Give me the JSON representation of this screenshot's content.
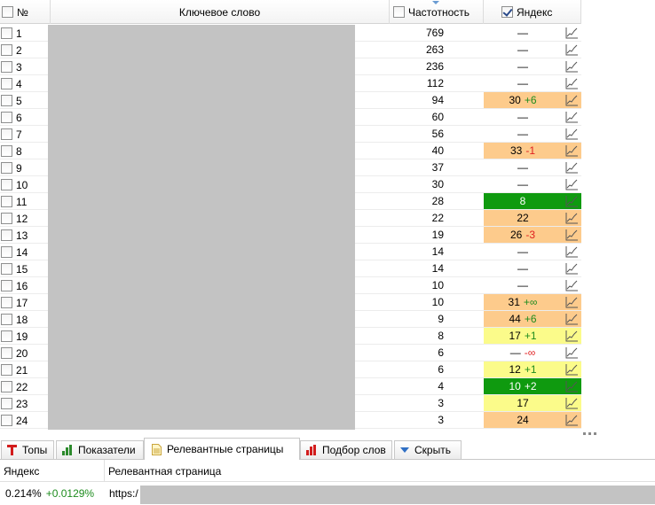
{
  "grid": {
    "columns": {
      "num": "№",
      "keyword": "Ключевое слово",
      "frequency": "Частотность",
      "yandex": "Яндекс"
    },
    "rows": [
      {
        "num": "1",
        "freq": "769",
        "rank": "—",
        "delta": "",
        "dir": "",
        "bg": ""
      },
      {
        "num": "2",
        "freq": "263",
        "rank": "—",
        "delta": "",
        "dir": "",
        "bg": ""
      },
      {
        "num": "3",
        "freq": "236",
        "rank": "—",
        "delta": "",
        "dir": "",
        "bg": ""
      },
      {
        "num": "4",
        "freq": "112",
        "rank": "—",
        "delta": "",
        "dir": "",
        "bg": ""
      },
      {
        "num": "5",
        "freq": "94",
        "rank": "30",
        "delta": "+6",
        "dir": "up",
        "bg": "#fdcb8c"
      },
      {
        "num": "6",
        "freq": "60",
        "rank": "—",
        "delta": "",
        "dir": "",
        "bg": ""
      },
      {
        "num": "7",
        "freq": "56",
        "rank": "—",
        "delta": "",
        "dir": "",
        "bg": ""
      },
      {
        "num": "8",
        "freq": "40",
        "rank": "33",
        "delta": "-1",
        "dir": "down",
        "bg": "#fdcb8c"
      },
      {
        "num": "9",
        "freq": "37",
        "rank": "—",
        "delta": "",
        "dir": "",
        "bg": ""
      },
      {
        "num": "10",
        "freq": "30",
        "rank": "—",
        "delta": "",
        "dir": "",
        "bg": ""
      },
      {
        "num": "11",
        "freq": "28",
        "rank": "8",
        "delta": "",
        "dir": "",
        "bg": "#0f9a0f",
        "fg": "#ffffff"
      },
      {
        "num": "12",
        "freq": "22",
        "rank": "22",
        "delta": "",
        "dir": "",
        "bg": "#fdcb8c"
      },
      {
        "num": "13",
        "freq": "19",
        "rank": "26",
        "delta": "-3",
        "dir": "down",
        "bg": "#fdcb8c"
      },
      {
        "num": "14",
        "freq": "14",
        "rank": "—",
        "delta": "",
        "dir": "",
        "bg": ""
      },
      {
        "num": "15",
        "freq": "14",
        "rank": "—",
        "delta": "",
        "dir": "",
        "bg": ""
      },
      {
        "num": "16",
        "freq": "10",
        "rank": "—",
        "delta": "",
        "dir": "",
        "bg": ""
      },
      {
        "num": "17",
        "freq": "10",
        "rank": "31",
        "delta": "+∞",
        "dir": "up",
        "bg": "#fdcb8c"
      },
      {
        "num": "18",
        "freq": "9",
        "rank": "44",
        "delta": "+6",
        "dir": "up",
        "bg": "#fdcb8c"
      },
      {
        "num": "19",
        "freq": "8",
        "rank": "17",
        "delta": "+1",
        "dir": "up",
        "bg": "#fbfb8a"
      },
      {
        "num": "20",
        "freq": "6",
        "rank": "—",
        "delta": "-∞",
        "dir": "down",
        "bg": ""
      },
      {
        "num": "21",
        "freq": "6",
        "rank": "12",
        "delta": "+1",
        "dir": "up",
        "bg": "#fbfb8a"
      },
      {
        "num": "22",
        "freq": "4",
        "rank": "10",
        "delta": "+2",
        "dir": "up",
        "bg": "#0f9a0f",
        "fg": "#ffffff"
      },
      {
        "num": "23",
        "freq": "3",
        "rank": "17",
        "delta": "",
        "dir": "",
        "bg": "#fbfb8a"
      },
      {
        "num": "24",
        "freq": "3",
        "rank": "24",
        "delta": "",
        "dir": "",
        "bg": "#fdcb8c"
      }
    ]
  },
  "tabs": [
    {
      "label": "Топы",
      "icon": "tops-icon",
      "active": false
    },
    {
      "label": "Показатели",
      "icon": "bar-chart-icon",
      "active": false
    },
    {
      "label": "Релевантные страницы",
      "icon": "page-icon",
      "active": true
    },
    {
      "label": "Подбор слов",
      "icon": "red-bar-chart-icon",
      "active": false
    },
    {
      "label": "Скрыть",
      "icon": "triangle-down-icon",
      "active": false
    }
  ],
  "bottom": {
    "columns": {
      "engine": "Яндекс",
      "page": "Релевантная страница"
    },
    "row": {
      "pct": "0.214%",
      "pct_delta": "+0.0129%",
      "url": "https:/"
    }
  },
  "colors": {
    "orange": "#fdcb8c",
    "yellow": "#fbfb8a",
    "green": "#0f9a0f",
    "up": "#1e8c1e",
    "down": "#e02020"
  }
}
